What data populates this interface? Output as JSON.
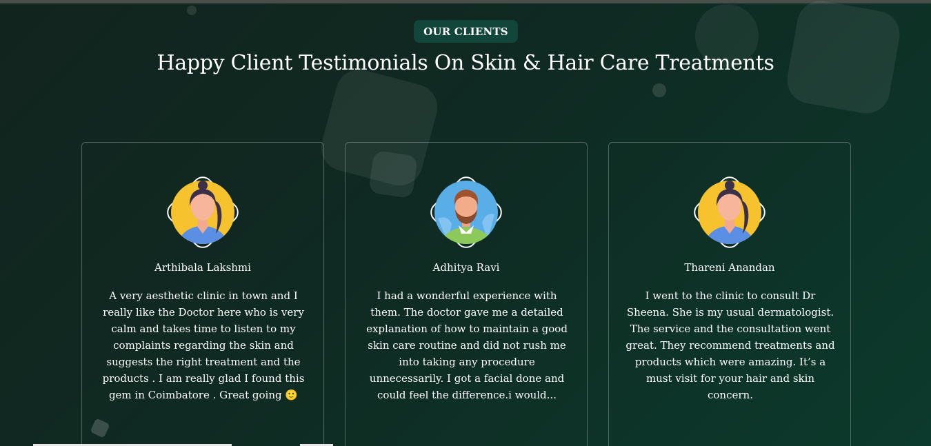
{
  "section": {
    "badge": "OUR CLIENTS",
    "heading": "Happy Client Testimonials On Skin & Hair Care Treatments"
  },
  "testimonials": [
    {
      "name": "Arthibala Lakshmi",
      "avatar": "female-avatar-icon",
      "text": "A very aesthetic clinic in town and I really like the Doctor here who is very calm and takes time to listen to my complaints regarding the skin and suggests the right treatment and the products . I am really glad I found this gem in Coimbatore . Great going 🙂"
    },
    {
      "name": "Adhitya Ravi",
      "avatar": "male-avatar-icon",
      "text": "I had a wonderful experience with them. The doctor gave me a detailed explanation of how to maintain a good skin care routine and did not rush me into taking any procedure unnecessarily. I got a facial done and could feel the difference.i would..."
    },
    {
      "name": "Thareni Anandan",
      "avatar": "female-avatar-icon",
      "text": "I went to the clinic to consult Dr Sheena. She is my usual dermatologist. The service and the consultation went great. They recommend treatments and products which were amazing. It’s a must visit for your hair and skin concern."
    }
  ],
  "colors": {
    "background_start": "#12241e",
    "background_end": "#0c3a2c",
    "badge_bg": "#12463a",
    "female_avatar_bg": "#f6c22e",
    "male_avatar_bg": "#5aaee8"
  }
}
